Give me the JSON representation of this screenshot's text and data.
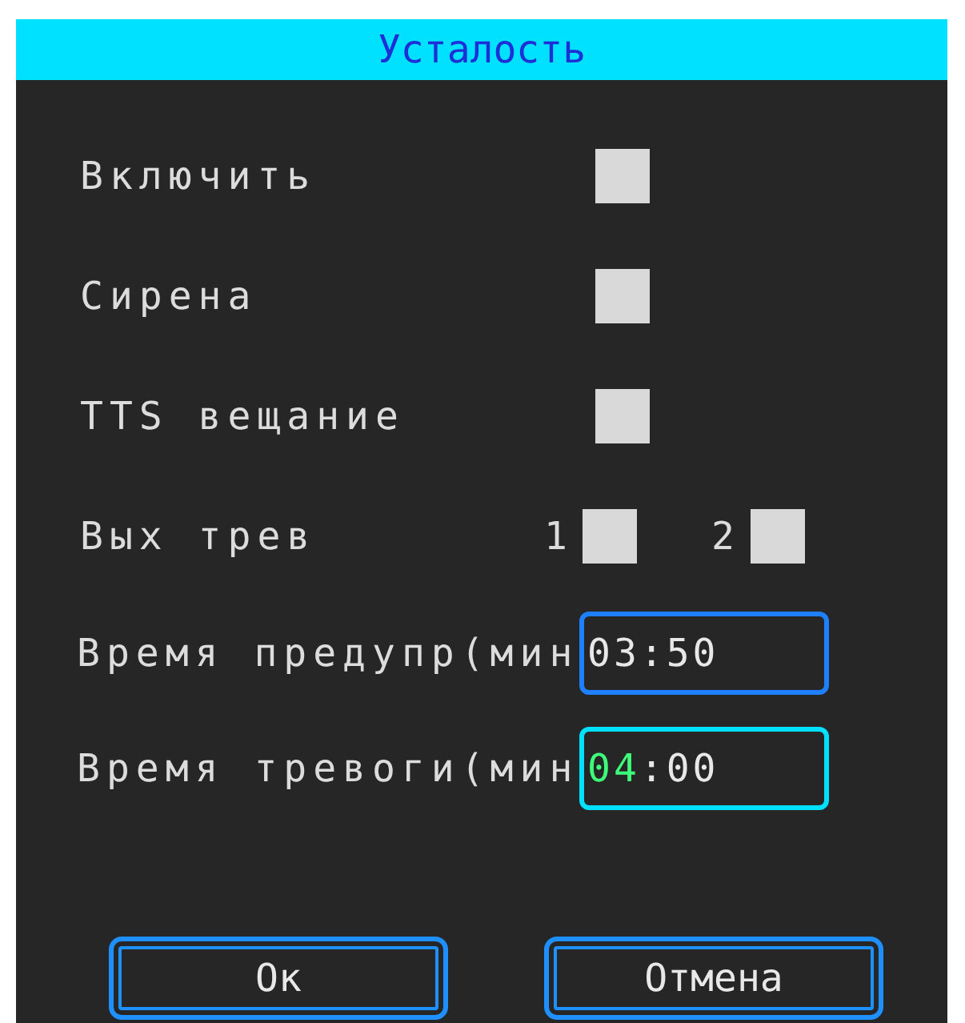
{
  "window": {
    "title": "Усталость"
  },
  "settings": [
    {
      "kind": "checkbox",
      "label": "Включить",
      "checked": false
    },
    {
      "kind": "checkbox",
      "label": "Сирена",
      "checked": false
    },
    {
      "kind": "checkbox",
      "label": "TTS вещание",
      "checked": false
    },
    {
      "kind": "outputs",
      "label": "Вых трев",
      "outputs": [
        {
          "label": "1",
          "checked": false
        },
        {
          "label": "2",
          "checked": false
        }
      ]
    },
    {
      "kind": "time",
      "label": "Время предупр(мин",
      "focused": false,
      "parts": [
        {
          "text": "03",
          "selected": false
        },
        {
          "text": ":",
          "selected": false
        },
        {
          "text": "50",
          "selected": false
        }
      ]
    },
    {
      "kind": "time",
      "label": "Время тревоги(мин",
      "focused": true,
      "parts": [
        {
          "text": "04",
          "selected": true
        },
        {
          "text": ":",
          "selected": false
        },
        {
          "text": "00",
          "selected": false
        }
      ]
    }
  ],
  "buttons": [
    {
      "label": "Ок"
    },
    {
      "label": "Отмена"
    }
  ]
}
